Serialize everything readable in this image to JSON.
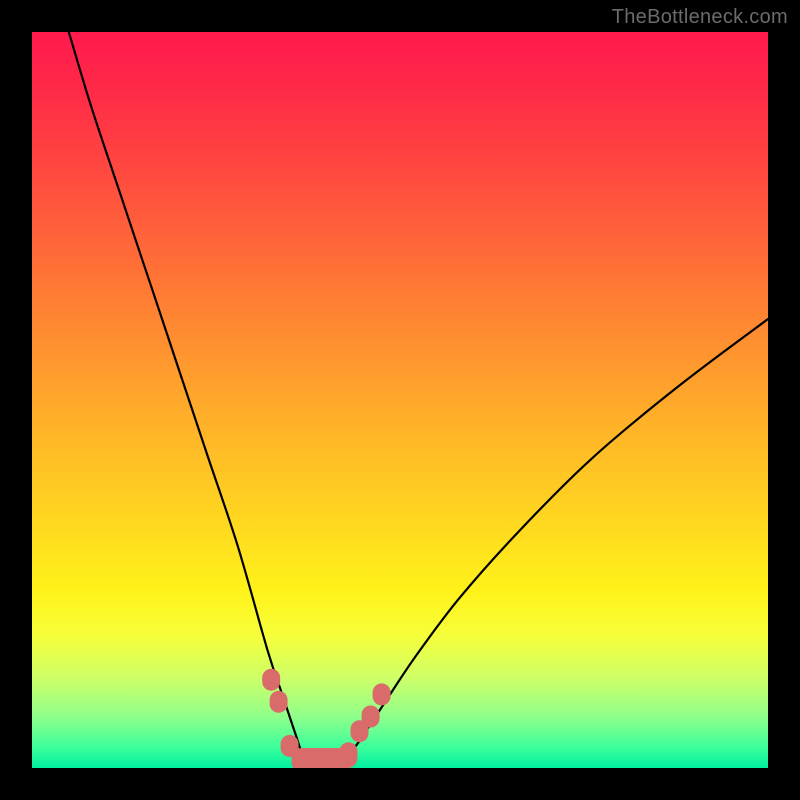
{
  "watermark": {
    "text": "TheBottleneck.com"
  },
  "chart_data": {
    "type": "line",
    "title": "",
    "xlabel": "",
    "ylabel": "",
    "xlim": [
      0,
      100
    ],
    "ylim": [
      0,
      100
    ],
    "grid": false,
    "series": [
      {
        "name": "bottleneck-curve",
        "x": [
          5,
          8,
          12,
          16,
          20,
          24,
          28,
          32,
          34,
          36,
          37,
          38,
          39,
          40,
          42,
          44,
          46,
          48,
          52,
          58,
          66,
          76,
          88,
          100
        ],
        "y": [
          100,
          90,
          78,
          66,
          54,
          42,
          30,
          16,
          10,
          4,
          1,
          0,
          0,
          0,
          1,
          3,
          6,
          9,
          15,
          23,
          32,
          42,
          52,
          61
        ]
      }
    ],
    "markers": {
      "name": "highlight-region",
      "color": "#d96b6b",
      "x": [
        32.5,
        33.5,
        35.0,
        36.5,
        38.0,
        39.5,
        41.0,
        43.0,
        44.5,
        46.0,
        47.5
      ],
      "y": [
        12,
        9,
        3,
        1,
        0,
        0,
        0,
        2,
        5,
        7,
        10
      ]
    },
    "gradient_bg": {
      "top_color": "#ff1a4d",
      "mid_color": "#ffd620",
      "bottom_color": "#00f0a0"
    }
  }
}
